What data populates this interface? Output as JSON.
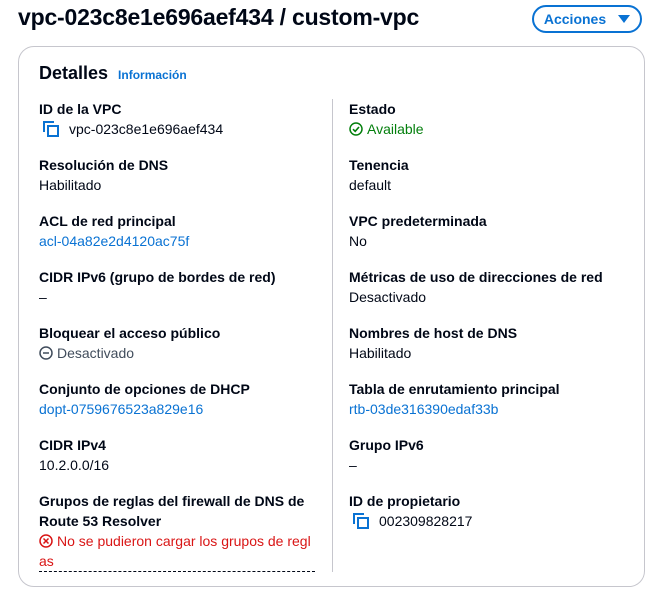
{
  "header": {
    "title": "vpc-023c8e1e696aef434 / custom-vpc",
    "actions_label": "Acciones"
  },
  "panel": {
    "title": "Detalles",
    "info_link": "Información"
  },
  "left": {
    "vpc_id": {
      "label": "ID de la VPC",
      "value": "vpc-023c8e1e696aef434"
    },
    "dns_resolution": {
      "label": "Resolución de DNS",
      "value": "Habilitado"
    },
    "main_acl": {
      "label": "ACL de red principal",
      "value": "acl-04a82e2d4120ac75f"
    },
    "ipv6_cidr_border": {
      "label": "CIDR IPv6 (grupo de bordes de red)",
      "value": "–"
    },
    "block_public_access": {
      "label": "Bloquear el acceso público",
      "value": "Desactivado"
    },
    "dhcp_options": {
      "label": "Conjunto de opciones de DHCP",
      "value": "dopt-0759676523a829e16"
    },
    "ipv4_cidr": {
      "label": "CIDR IPv4",
      "value": "10.2.0.0/16"
    },
    "dns_firewall": {
      "label_line1": "Grupos de reglas del firewall de DNS de",
      "label_line2": "Route 53 Resolver",
      "error_line1": "No se pudieron cargar los grupos de regl",
      "error_line2": "as"
    }
  },
  "right": {
    "state": {
      "label": "Estado",
      "value": "Available"
    },
    "tenancy": {
      "label": "Tenencia",
      "value": "default"
    },
    "default_vpc": {
      "label": "VPC predeterminada",
      "value": "No"
    },
    "ip_usage_metrics": {
      "label": "Métricas de uso de direcciones de red",
      "value": "Desactivado"
    },
    "dns_hostnames": {
      "label": "Nombres de host de DNS",
      "value": "Habilitado"
    },
    "main_route_table": {
      "label": "Tabla de enrutamiento principal",
      "value": "rtb-03de316390edaf33b"
    },
    "ipv6_pool": {
      "label": "Grupo IPv6",
      "value": "–"
    },
    "owner_id": {
      "label": "ID de propietario",
      "value": "002309828217"
    }
  },
  "colors": {
    "link": "#0972d3",
    "success": "#037f0c",
    "error": "#d91515",
    "border": "#c6c6cd"
  },
  "icons": [
    "copy-icon",
    "check-circle-icon",
    "minus-circle-icon",
    "error-x-circle-icon",
    "caret-down-icon"
  ]
}
